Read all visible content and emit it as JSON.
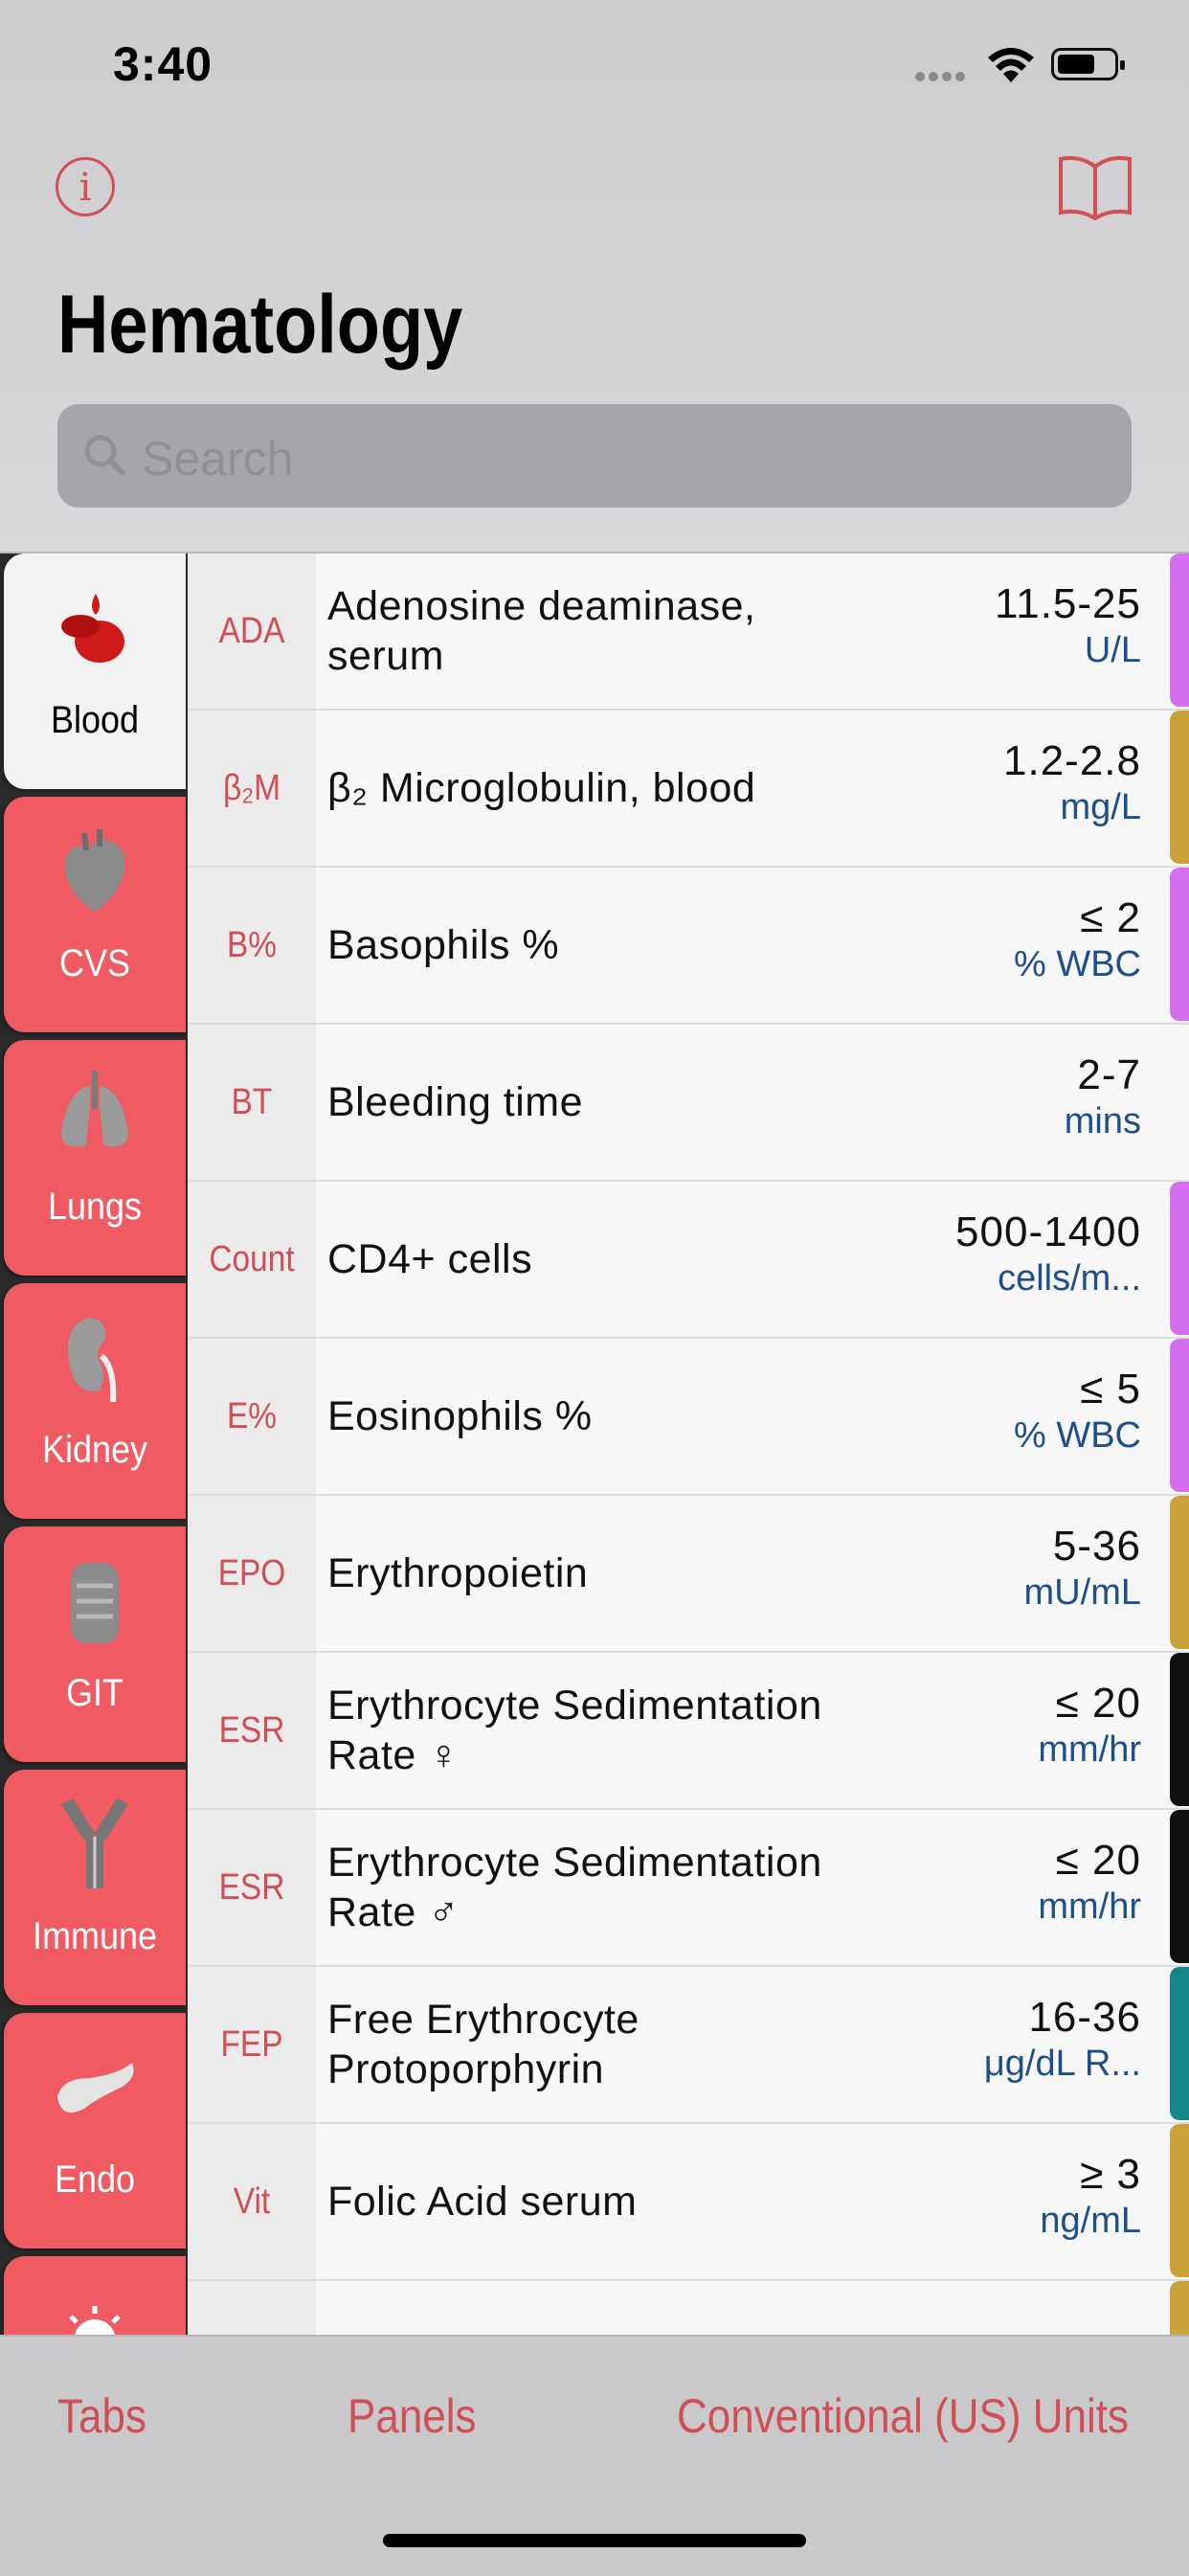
{
  "status": {
    "time": "3:40"
  },
  "nav": {
    "title": "Hematology",
    "info_icon": "info-icon",
    "book_icon": "book-icon"
  },
  "search": {
    "placeholder": "Search"
  },
  "sidebar": {
    "tabs": [
      {
        "label": "Blood",
        "icon": "blood-drop-icon",
        "active": true
      },
      {
        "label": "CVS",
        "icon": "heart-icon"
      },
      {
        "label": "Lungs",
        "icon": "lungs-icon"
      },
      {
        "label": "Kidney",
        "icon": "kidney-icon"
      },
      {
        "label": "GIT",
        "icon": "intestine-icon"
      },
      {
        "label": "Immune",
        "icon": "antibody-icon"
      },
      {
        "label": "Endo",
        "icon": "pancreas-icon"
      },
      {
        "label": "",
        "icon": "sun-icon"
      }
    ]
  },
  "tests": [
    {
      "abbr": "ADA",
      "name": "Adenosine deaminase, serum",
      "range": "11.5-25",
      "unit": "U/L",
      "color": "#d66ef0"
    },
    {
      "abbr": "β₂M",
      "name": "β₂ Microglobulin, blood",
      "range": "1.2-2.8",
      "unit": "mg/L",
      "color": "#c9a23a"
    },
    {
      "abbr": "B%",
      "name": "Basophils %",
      "range": "≤ 2",
      "unit": "% WBC",
      "color": "#d66ef0"
    },
    {
      "abbr": "BT",
      "name": "Bleeding time",
      "range": "2-7",
      "unit": "mins",
      "color": ""
    },
    {
      "abbr": "Count",
      "name": "CD4+ cells",
      "range": "500-1400",
      "unit": "cells/m...",
      "color": "#d66ef0"
    },
    {
      "abbr": "E%",
      "name": "Eosinophils %",
      "range": "≤ 5",
      "unit": "% WBC",
      "color": "#d66ef0"
    },
    {
      "abbr": "EPO",
      "name": "Erythropoietin",
      "range": "5-36",
      "unit": "mU/mL",
      "color": "#c9a23a"
    },
    {
      "abbr": "ESR",
      "name": "Erythrocyte Sedimentation Rate ♀",
      "range": "≤ 20",
      "unit": "mm/hr",
      "color": "#111111"
    },
    {
      "abbr": "ESR",
      "name": "Erythrocyte Sedimentation Rate ♂",
      "range": "≤ 20",
      "unit": "mm/hr",
      "color": "#111111"
    },
    {
      "abbr": "FEP",
      "name": "Free Erythrocyte Protoporphyrin",
      "range": "16-36",
      "unit": "μg/dL R...",
      "color": "#15868a"
    },
    {
      "abbr": "Vit",
      "name": "Folic Acid serum",
      "range": "≥ 3",
      "unit": "ng/mL",
      "color": "#c9a23a"
    },
    {
      "abbr": "",
      "name": "",
      "range": "",
      "unit": "",
      "color": "#c9a23a"
    }
  ],
  "bottom": {
    "tabs_label": "Tabs",
    "panels_label": "Panels",
    "units_label": "Conventional (US) Units"
  }
}
